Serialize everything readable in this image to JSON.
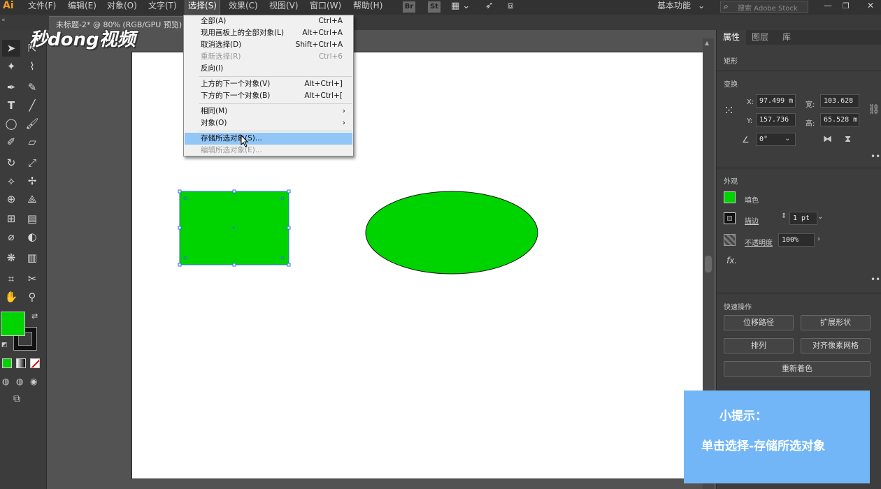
{
  "app": {
    "logo": "Ai",
    "doc_tab": "未标题-2* @ 80% (RGB/GPU 预览)"
  },
  "watermark": {
    "text": "秒dong视频"
  },
  "menubar": {
    "items": [
      "文件(F)",
      "编辑(E)",
      "对象(O)",
      "文字(T)",
      "选择(S)",
      "效果(C)",
      "视图(V)",
      "窗口(W)",
      "帮助(H)"
    ],
    "bridge": "Br",
    "stock": "St",
    "workspace": "基本功能",
    "search_placeholder": "搜索 Adobe Stock"
  },
  "select_menu": {
    "items": [
      {
        "label": "全部(A)",
        "shortcut": "Ctrl+A"
      },
      {
        "label": "现用画板上的全部对象(L)",
        "shortcut": "Alt+Ctrl+A"
      },
      {
        "label": "取消选择(D)",
        "shortcut": "Shift+Ctrl+A"
      },
      {
        "label": "重新选择(R)",
        "shortcut": "Ctrl+6",
        "disabled": true
      },
      {
        "label": "反向(I)",
        "shortcut": ""
      },
      {
        "label": "上方的下一个对象(V)",
        "shortcut": "Alt+Ctrl+]"
      },
      {
        "label": "下方的下一个对象(B)",
        "shortcut": "Alt+Ctrl+["
      },
      {
        "label": "相同(M)",
        "submenu": true
      },
      {
        "label": "对象(O)",
        "submenu": true
      },
      {
        "label": "存储所选对象(S)...",
        "highlighted": true
      },
      {
        "label": "编辑所选对象(E)...",
        "disabled": true
      }
    ]
  },
  "panel": {
    "tabs": [
      "属性",
      "图层",
      "库"
    ],
    "object_type": "矩形",
    "transform": {
      "title": "变换",
      "x_label": "X:",
      "x": "97.499 m",
      "y_label": "Y:",
      "y": "157.736",
      "w_label": "宽:",
      "w": "103.628",
      "h_label": "高:",
      "h": "65.528 m",
      "angle": "0°"
    },
    "appearance": {
      "title": "外观",
      "fill_label": "填色",
      "stroke_label": "描边",
      "stroke_value": "1 pt",
      "opacity_label": "不透明度",
      "opacity_value": "100%",
      "fx": "fx."
    },
    "quick_actions": {
      "title": "快速操作",
      "buttons": [
        "位移路径",
        "扩展形状",
        "排列",
        "对齐像素网格",
        "重新着色"
      ]
    }
  },
  "hint": {
    "title": "小提示：",
    "body": "单击选择-存储所选对象"
  },
  "colors": {
    "fill": "#00d400",
    "stroke": "#000000",
    "menu_highlight": "#91c6f7",
    "hint_bg": "#72b6f8"
  }
}
